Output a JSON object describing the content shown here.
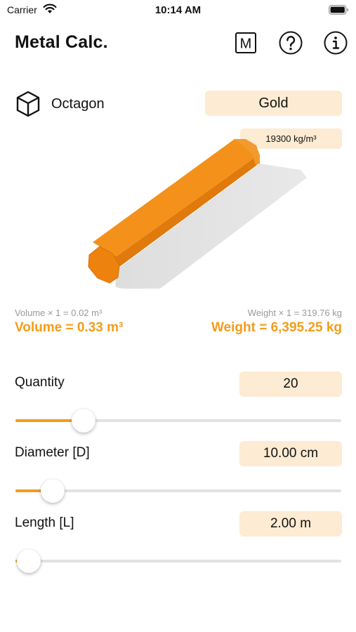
{
  "status_bar": {
    "carrier": "Carrier",
    "time": "10:14 AM"
  },
  "header": {
    "title": "Metal Calc.",
    "m_button_label": "M",
    "icons": [
      "metric-icon",
      "help-icon",
      "info-icon"
    ]
  },
  "shape": {
    "icon": "cube-icon",
    "label": "Octagon"
  },
  "material": {
    "label": "Gold",
    "density": "19300 kg/m³"
  },
  "results": {
    "single_volume": "Volume × 1 = 0.02 m³",
    "single_weight": "Weight × 1 = 319.76 kg",
    "total_volume": "Volume = 0.33 m³",
    "total_weight": "Weight = 6,395.25 kg"
  },
  "params": {
    "quantity": {
      "label": "Quantity",
      "value": "20",
      "slider_fraction": 0.21
    },
    "diameter": {
      "label": "Diameter [D]",
      "value": "10.00 cm",
      "slider_fraction": 0.115
    },
    "length": {
      "label": "Length [L]",
      "value": "2.00 m",
      "slider_fraction": 0.04
    }
  },
  "colors": {
    "accent": "#f39c1c",
    "field_bg": "#fdebd3",
    "track": "#e2e2e2"
  }
}
